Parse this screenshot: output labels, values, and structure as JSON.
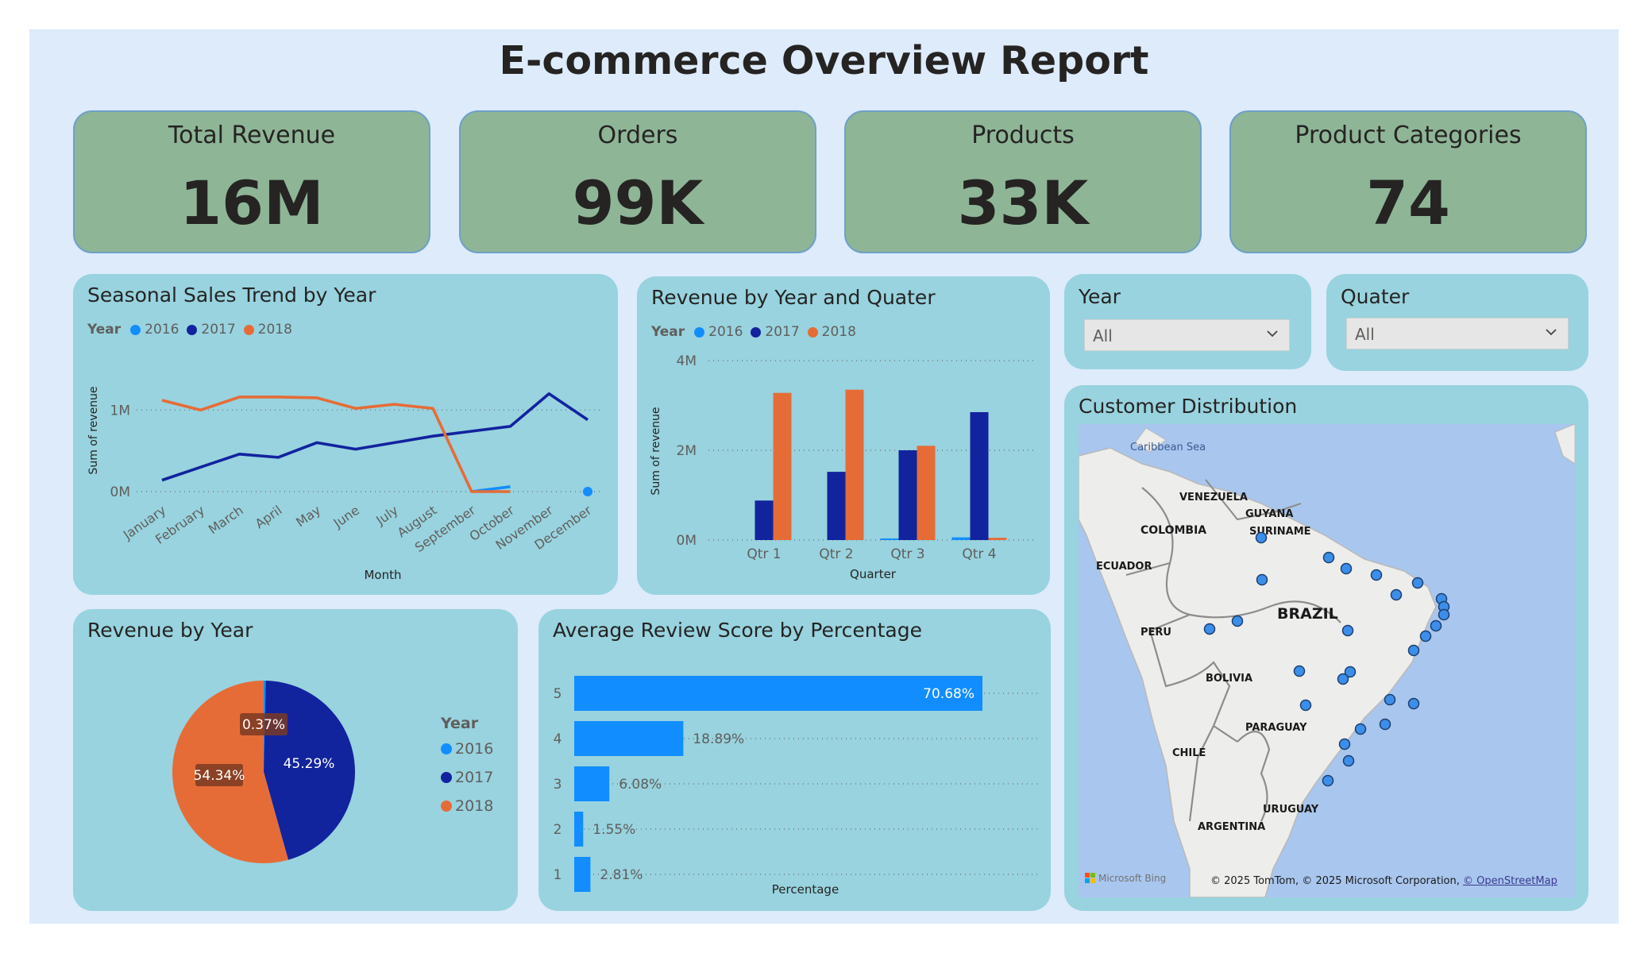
{
  "report": {
    "title": "E-commerce Overview Report"
  },
  "kpis": [
    {
      "label": "Total Revenue",
      "value": "16M"
    },
    {
      "label": "Orders",
      "value": "99K"
    },
    {
      "label": "Products",
      "value": "33K"
    },
    {
      "label": "Product Categories",
      "value": "74"
    }
  ],
  "colors": {
    "y2016": "#118dff",
    "y2017": "#12239e",
    "y2018": "#e66c37",
    "kpi_bg": "#8fb597",
    "panel_bg": "#98d3df",
    "canvas_bg": "#ddebfb"
  },
  "legend": {
    "title": "Year",
    "items": [
      "2016",
      "2017",
      "2018"
    ]
  },
  "filters": {
    "year": {
      "title": "Year",
      "value": "All",
      "icon": "chevron-down-icon"
    },
    "quarter": {
      "title": "Quater",
      "value": "All",
      "icon": "chevron-down-icon"
    }
  },
  "map": {
    "title": "Customer Distribution",
    "attribution": "© 2025 TomTom, © 2025 Microsoft Corporation,",
    "attribution_link": "© OpenStreetMap",
    "provider": "Microsoft Bing",
    "labels": [
      "Caribbean Sea",
      "VENEZUELA",
      "GUYANA",
      "SURINAME",
      "COLOMBIA",
      "ECUADOR",
      "BRAZIL",
      "PERU",
      "BOLIVIA",
      "PARAGUAY",
      "CHILE",
      "URUGUAY",
      "ARGENTINA"
    ]
  },
  "chart_data": [
    {
      "type": "line",
      "title": "Seasonal Sales Trend by Year",
      "xlabel": "Month",
      "ylabel": "Sum of revenue",
      "categories": [
        "January",
        "February",
        "March",
        "April",
        "May",
        "June",
        "July",
        "August",
        "September",
        "October",
        "November",
        "December"
      ],
      "y_ticks": [
        "0M",
        "1M"
      ],
      "ylim": [
        0,
        1.5
      ],
      "series": [
        {
          "name": "2016",
          "values": [
            null,
            null,
            null,
            null,
            null,
            null,
            null,
            null,
            0.0,
            0.06,
            null,
            0.0
          ]
        },
        {
          "name": "2017",
          "values": [
            0.14,
            0.3,
            0.46,
            0.42,
            0.6,
            0.52,
            0.6,
            0.68,
            0.74,
            0.8,
            1.2,
            0.88
          ]
        },
        {
          "name": "2018",
          "values": [
            1.12,
            1.0,
            1.16,
            1.16,
            1.15,
            1.02,
            1.07,
            1.02,
            0.0,
            0.0,
            null,
            null
          ]
        }
      ],
      "legend_position": "top-left",
      "grid": true
    },
    {
      "type": "bar",
      "title": "Revenue by Year and Quater",
      "xlabel": "Quarter",
      "ylabel": "Sum of revenue",
      "categories": [
        "Qtr 1",
        "Qtr 2",
        "Qtr 3",
        "Qtr 4"
      ],
      "y_ticks": [
        "0M",
        "2M",
        "4M"
      ],
      "ylim": [
        0,
        4
      ],
      "series": [
        {
          "name": "2016",
          "values": [
            0,
            0,
            0.03,
            0.06
          ]
        },
        {
          "name": "2017",
          "values": [
            0.88,
            1.52,
            2.0,
            2.85
          ]
        },
        {
          "name": "2018",
          "values": [
            3.28,
            3.35,
            2.1,
            0.05
          ]
        }
      ],
      "legend_position": "top-left",
      "grid": true
    },
    {
      "type": "pie",
      "title": "Revenue by Year",
      "categories": [
        "2016",
        "2017",
        "2018"
      ],
      "values": [
        0.37,
        45.29,
        54.34
      ],
      "labels": [
        "0.37%",
        "45.29%",
        "54.34%"
      ],
      "legend_position": "right"
    },
    {
      "type": "bar",
      "orientation": "horizontal",
      "title": "Average Review Score by Percentage",
      "xlabel": "Percentage",
      "categories": [
        "5",
        "4",
        "3",
        "2",
        "1"
      ],
      "values": [
        70.68,
        18.89,
        6.08,
        1.55,
        2.81
      ],
      "labels": [
        "70.68%",
        "18.89%",
        "6.08%",
        "1.55%",
        "2.81%"
      ],
      "grid": true
    }
  ]
}
